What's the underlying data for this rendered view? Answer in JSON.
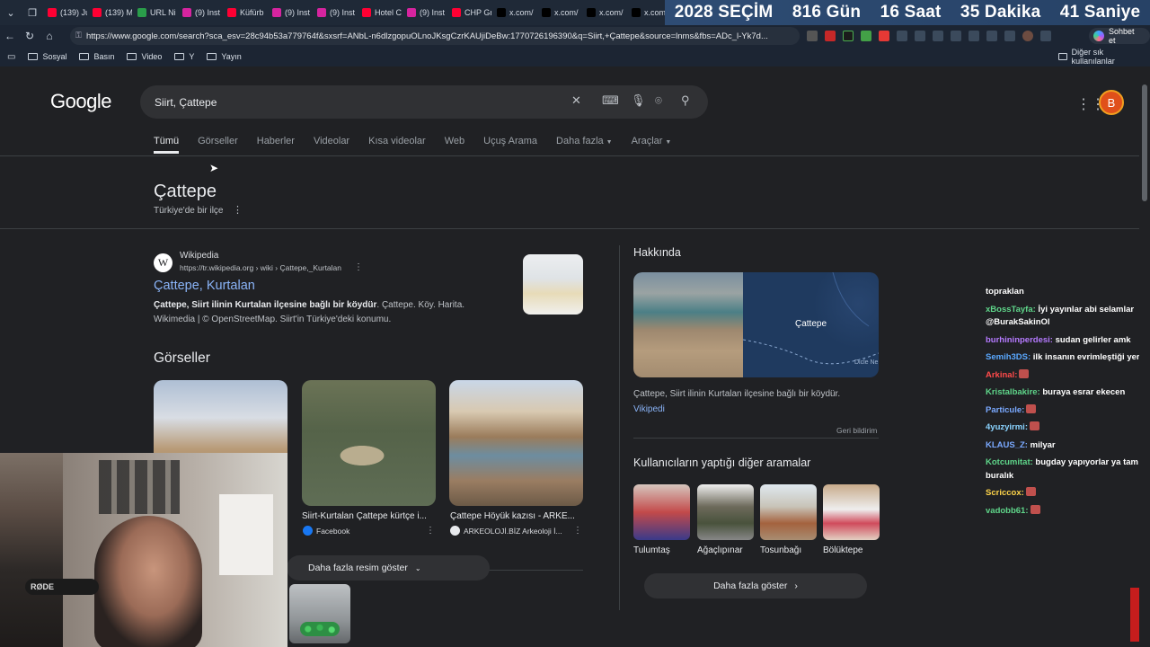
{
  "browser": {
    "tabs": [
      {
        "label": "(139) Ju",
        "color": "#ff0033"
      },
      {
        "label": "(139) M",
        "color": "#ff0033"
      },
      {
        "label": "URL Ni",
        "color": "#2a9d4a"
      },
      {
        "label": "(9) Inst",
        "color": "#d6249f"
      },
      {
        "label": "Küfürb",
        "color": "#ff0033"
      },
      {
        "label": "(9) Inst",
        "color": "#d6249f"
      },
      {
        "label": "(9) Inst",
        "color": "#d6249f"
      },
      {
        "label": "Hotel C",
        "color": "#ff0033"
      },
      {
        "label": "(9) Inst",
        "color": "#d6249f"
      },
      {
        "label": "CHP Gr",
        "color": "#ff0033"
      },
      {
        "label": "x.com/",
        "color": "#000000"
      },
      {
        "label": "x.com/",
        "color": "#000000"
      },
      {
        "label": "x.com/",
        "color": "#000000"
      },
      {
        "label": "x.com/",
        "color": "#000000"
      }
    ],
    "countdown": {
      "year_label": "2028 SEÇİM",
      "days": "816 Gün",
      "hours": "16 Saat",
      "minutes": "35 Dakika",
      "seconds": "41 Saniye"
    },
    "url": "https://www.google.com/search?sca_esv=28c94b53a779764f&sxsrf=ANbL-n6dlzgopuOLnoJKsgCzrKAUjiDeBw:1770726196390&q=Siirt,+Çattepe&source=lnms&fbs=ADc_l-Yk7d...",
    "copilot_label": "Sohbet et",
    "bookmarks": [
      "Sosyal",
      "Basın",
      "Video",
      "Y",
      "Yayın"
    ],
    "other_bookmarks": "Diğer sık kullanılanlar"
  },
  "google": {
    "logo": "Google",
    "query": "Siirt, Çattepe",
    "avatar_letter": "B",
    "tabs": [
      "Tümü",
      "Görseller",
      "Haberler",
      "Videolar",
      "Kısa videolar",
      "Web",
      "Uçuş Arama",
      "Daha fazla",
      "Araçlar"
    ],
    "entity": {
      "title": "Çattepe",
      "subtitle": "Türkiye'de bir ilçe"
    },
    "wiki_result": {
      "source": "Wikipedia",
      "url": "https://tr.wikipedia.org › wiki › Çattepe,_Kurtalan",
      "title": "Çattepe, Kurtalan",
      "desc_bold": "Çattepe, Siirt ilinin Kurtalan ilçesine bağlı bir köydür",
      "desc_rest": ". Çattepe. Köy. Harita. Wikimedia | © OpenStreetMap. Siirt'in Türkiye'deki konumu."
    },
    "images": {
      "heading": "Görseller",
      "items": [
        {
          "caption": "",
          "source": ""
        },
        {
          "caption": "Siirt-Kurtalan Çattepe kürtçe i...",
          "source": "Facebook"
        },
        {
          "caption": "Çattepe Höyük kazısı - ARKE...",
          "source": "ARKEOLOJİ.BİZ Arkeoloji İ..."
        }
      ],
      "more_label": "Daha fazla resim göster"
    },
    "about": {
      "heading": "Hakkında",
      "map_label": "Çattepe",
      "map_river": "Dicle Ne",
      "text": "Çattepe, Siirt ilinin Kurtalan ilçesine bağlı bir köydür.",
      "link": "Vikipedi",
      "feedback": "Geri bildirim"
    },
    "others": {
      "heading": "Kullanıcıların yaptığı diğer aramalar",
      "items": [
        "Tulumtaş",
        "Ağaçlıpınar",
        "Tosunbağı",
        "Bölüktepe"
      ],
      "more_label": "Daha fazla göster"
    }
  },
  "chat": [
    {
      "user": "",
      "text": "topraklan",
      "color": "#ffffff"
    },
    {
      "user": "xBossTayfa:",
      "text": " İyi yayınlar abi selamlar  @BurakSakinOl",
      "color": "#5fd68a"
    },
    {
      "user": "burhininperdesi:",
      "text": " sudan gelirler amk",
      "color": "#b57aff"
    },
    {
      "user": "Semih3DS:",
      "text": " ilk insanın evrimleştiği yer",
      "color": "#5aa8ff"
    },
    {
      "user": "Arkinal:",
      "text": "",
      "color": "#ff4a4a"
    },
    {
      "user": "Kristalbakire:",
      "text": " buraya esrar ekecen",
      "color": "#5fd68a"
    },
    {
      "user": "Particule:",
      "text": "",
      "color": "#7aa9ff"
    },
    {
      "user": "4yuzyirmi:",
      "text": "",
      "color": "#8ad3ff"
    },
    {
      "user": "KLAUS_Z:",
      "text": " milyar",
      "color": "#7aa9ff"
    },
    {
      "user": "Kotcumitat:",
      "text": " bugday yapıyorlar ya tam buralık",
      "color": "#5fd68a"
    },
    {
      "user": "Scriccox:",
      "text": "",
      "color": "#ffd54a"
    },
    {
      "user": "vadobb61:",
      "text": "",
      "color": "#5fd68a"
    }
  ],
  "webcam": {
    "mic_label": "RØDE"
  }
}
